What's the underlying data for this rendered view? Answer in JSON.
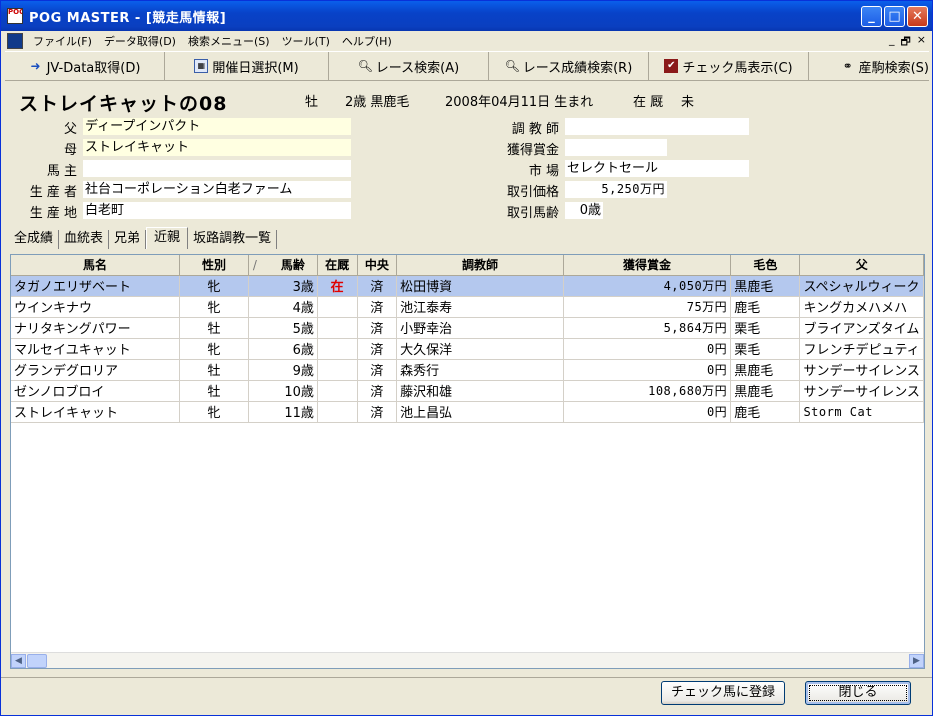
{
  "window": {
    "title": "POG MASTER - [競走馬情報]",
    "icon_text": "POG"
  },
  "menu": [
    "ファイル(F)",
    "データ取得(D)",
    "検索メニュー(S)",
    "ツール(T)",
    "ヘルプ(H)"
  ],
  "mdi_buttons": [
    "_",
    "🗗",
    "×"
  ],
  "toolbar": [
    {
      "label": "JV-Data取得(D)",
      "icon": "download-arrow-icon"
    },
    {
      "label": "開催日選択(M)",
      "icon": "calendar-icon"
    },
    {
      "label": "レース検索(A)",
      "icon": "magnifier-icon"
    },
    {
      "label": "レース成績検索(R)",
      "icon": "magnifier-icon"
    },
    {
      "label": "チェック馬表示(C)",
      "icon": "checkmark-pen-icon"
    },
    {
      "label": "産駒検索(S)",
      "icon": "binoculars-icon"
    }
  ],
  "horse": {
    "name": "ストレイキャットの08",
    "sex": "牡",
    "age_coat": "2歳 黒鹿毛",
    "birth": "2008年04月11日 生まれ",
    "status_label": "在 厩",
    "status_value": "未"
  },
  "fields_left": [
    {
      "label": "父",
      "value": "ディープインパクト",
      "yellow": true
    },
    {
      "label": "母",
      "value": "ストレイキャット",
      "yellow": true
    },
    {
      "label": "馬 主",
      "value": "",
      "yellow": false
    },
    {
      "label": "生 産 者",
      "value": "社台コーポレーション白老ファーム",
      "yellow": false
    },
    {
      "label": "生 産 地",
      "value": "白老町",
      "yellow": false
    }
  ],
  "fields_right": [
    {
      "label": "調 教 師",
      "value": ""
    },
    {
      "label": "獲得賞金",
      "value": ""
    },
    {
      "label": "市 場",
      "value": "セレクトセール"
    },
    {
      "label": "取引価格",
      "value": "5,250万円"
    },
    {
      "label": "取引馬齢",
      "value": "0歳"
    }
  ],
  "tabs": [
    "全成績",
    "血統表",
    "兄弟",
    "近親",
    "坂路調教一覧"
  ],
  "active_tab": "近親",
  "table": {
    "columns": [
      "馬名",
      "性別",
      "馬齢",
      "在厩",
      "中央",
      "調教師",
      "獲得賞金",
      "毛色",
      "父"
    ],
    "sort_marker": "/",
    "rows": [
      [
        "タガノエリザベート",
        "牝",
        "3歳",
        "在",
        "済",
        "松田博資",
        "4,050万円",
        "黒鹿毛",
        "スペシャルウィーク"
      ],
      [
        "ウインキナウ",
        "牝",
        "4歳",
        "",
        "済",
        "池江泰寿",
        "75万円",
        "鹿毛",
        "キングカメハメハ"
      ],
      [
        "ナリタキングパワー",
        "牡",
        "5歳",
        "",
        "済",
        "小野幸治",
        "5,864万円",
        "栗毛",
        "ブライアンズタイム"
      ],
      [
        "マルセイユキャット",
        "牝",
        "6歳",
        "",
        "済",
        "大久保洋",
        "0円",
        "栗毛",
        "フレンチデピュティ"
      ],
      [
        "グランデグロリア",
        "牡",
        "9歳",
        "",
        "済",
        "森秀行",
        "0円",
        "黒鹿毛",
        "サンデーサイレンス"
      ],
      [
        "ゼンノロブロイ",
        "牡",
        "10歳",
        "",
        "済",
        "藤沢和雄",
        "108,680万円",
        "黒鹿毛",
        "サンデーサイレンス"
      ],
      [
        "ストレイキャット",
        "牝",
        "11歳",
        "",
        "済",
        "池上昌弘",
        "0円",
        "鹿毛",
        "Storm Cat"
      ]
    ]
  },
  "buttons": {
    "register": "チェック馬に登録",
    "close": "閉じる"
  }
}
